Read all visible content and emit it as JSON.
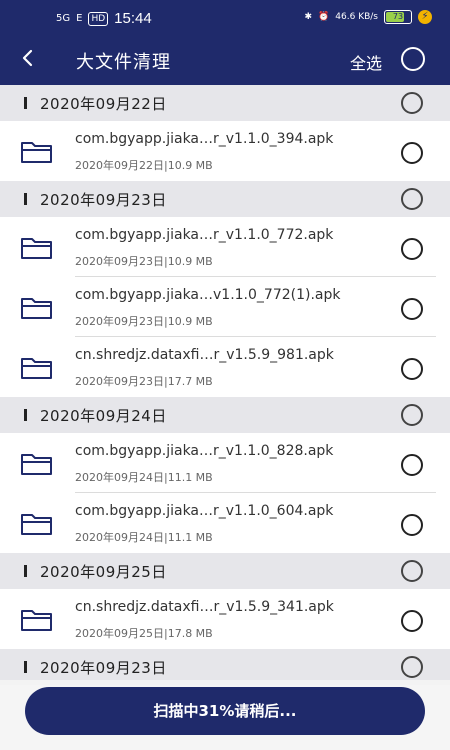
{
  "status_bar": {
    "network_5g": "5G",
    "network_e": "E",
    "hd": "HD",
    "time": "15:44",
    "speed": "46.6 KB/s",
    "battery": "73"
  },
  "nav": {
    "title": "大文件清理",
    "select_all": "全选"
  },
  "groups": [
    {
      "date": "2020年09月22日",
      "items": [
        {
          "name": "com.bgyapp.jiaka…r_v1.1.0_394.apk",
          "meta": "2020年09月22日|10.9 MB"
        }
      ]
    },
    {
      "date": "2020年09月23日",
      "items": [
        {
          "name": "com.bgyapp.jiaka…r_v1.1.0_772.apk",
          "meta": "2020年09月23日|10.9 MB"
        },
        {
          "name": "com.bgyapp.jiaka…v1.1.0_772(1).apk",
          "meta": "2020年09月23日|10.9 MB"
        },
        {
          "name": "cn.shredjz.dataxfi…r_v1.5.9_981.apk",
          "meta": "2020年09月23日|17.7 MB"
        }
      ]
    },
    {
      "date": "2020年09月24日",
      "items": [
        {
          "name": "com.bgyapp.jiaka…r_v1.1.0_828.apk",
          "meta": "2020年09月24日|11.1 MB"
        },
        {
          "name": "com.bgyapp.jiaka…r_v1.1.0_604.apk",
          "meta": "2020年09月24日|11.1 MB"
        }
      ]
    },
    {
      "date": "2020年09月25日",
      "items": [
        {
          "name": "cn.shredjz.dataxfi…r_v1.5.9_341.apk",
          "meta": "2020年09月25日|17.8 MB"
        }
      ]
    },
    {
      "date": "2020年09月23日",
      "items": []
    }
  ],
  "scan_button": {
    "label": "扫描中31%请稍后..."
  },
  "colors": {
    "header": "#1f2a6b",
    "group_bg": "#e6e6ea",
    "accent": "#1f2a6b"
  }
}
